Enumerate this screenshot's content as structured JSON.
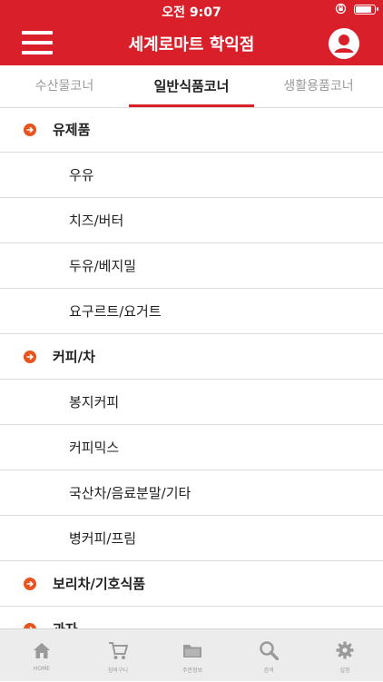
{
  "status_bar": {
    "time": "오전 9:07"
  },
  "header": {
    "title": "세계로마트 학익점",
    "menu_icon": "hamburger-icon",
    "profile_icon": "user-profile-icon"
  },
  "tabs": [
    {
      "label": "수산물코너",
      "active": false
    },
    {
      "label": "일반식품코너",
      "active": true
    },
    {
      "label": "생활용품코너",
      "active": false
    }
  ],
  "list": {
    "items": [
      {
        "label": "유제품",
        "type": "category"
      },
      {
        "label": "우유",
        "type": "subcategory"
      },
      {
        "label": "치즈/버터",
        "type": "subcategory"
      },
      {
        "label": "두유/베지밀",
        "type": "subcategory"
      },
      {
        "label": "요구르트/요거트",
        "type": "subcategory"
      },
      {
        "label": "커피/차",
        "type": "category"
      },
      {
        "label": "봉지커피",
        "type": "subcategory"
      },
      {
        "label": "커피믹스",
        "type": "subcategory"
      },
      {
        "label": "국산차/음료분말/기타",
        "type": "subcategory"
      },
      {
        "label": "병커피/프림",
        "type": "subcategory"
      },
      {
        "label": "보리차/기호식품",
        "type": "category"
      },
      {
        "label": "과자",
        "type": "category"
      }
    ]
  },
  "tab_bar": [
    {
      "label": "HOME",
      "icon": "home-icon"
    },
    {
      "label": "장바구니",
      "icon": "cart-icon"
    },
    {
      "label": "주문정보",
      "icon": "folder-icon"
    },
    {
      "label": "검색",
      "icon": "search-icon"
    },
    {
      "label": "설정",
      "icon": "gear-icon"
    }
  ],
  "colors": {
    "brand_red": "#d9202a",
    "accent_orange": "#e8541e",
    "tab_bar_bg": "#ececec"
  }
}
